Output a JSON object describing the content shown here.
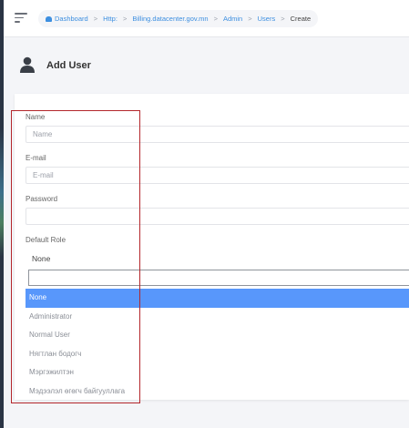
{
  "breadcrumb": {
    "items": [
      "Dashboard",
      "Http:",
      "Billing.datacenter.gov.mn",
      "Admin",
      "Users",
      "Create"
    ],
    "separator": ">"
  },
  "header": {
    "title": "Add User"
  },
  "form": {
    "name": {
      "label": "Name",
      "placeholder": "Name",
      "value": ""
    },
    "email": {
      "label": "E-mail",
      "placeholder": "E-mail",
      "value": ""
    },
    "password": {
      "label": "Password",
      "value": ""
    },
    "role": {
      "label": "Default Role",
      "selected": "None",
      "search_value": "",
      "options": [
        "None",
        "Administrator",
        "Normal User",
        "Нягтлан бодогч",
        "Мэргэжилтэн",
        "Мэдээлэл өгөгч байгууллага"
      ]
    }
  },
  "colors": {
    "accent": "#3d8fe0",
    "option_highlight": "#5897fb",
    "annotation_box": "#b3262b"
  }
}
